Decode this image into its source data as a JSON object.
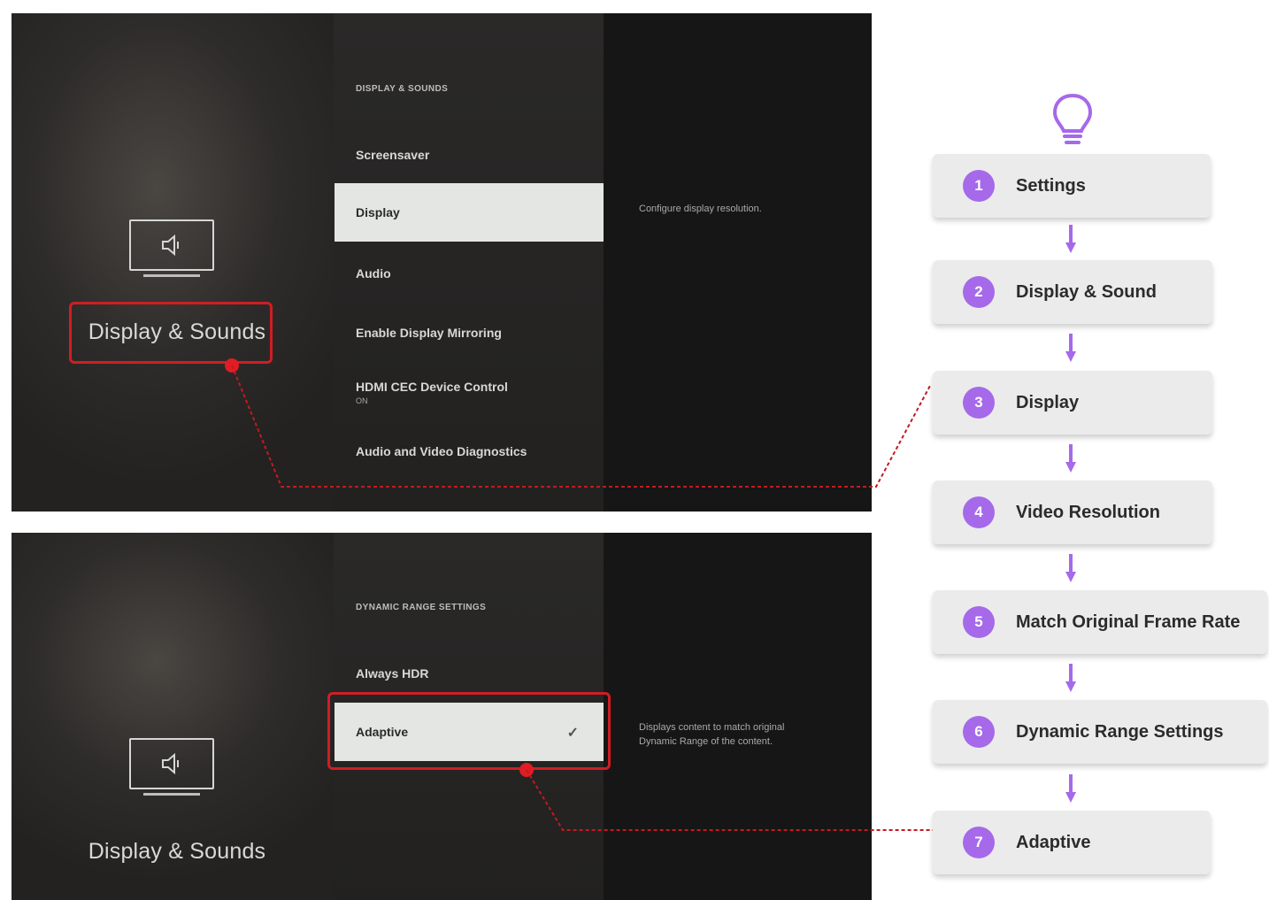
{
  "panels": [
    {
      "section_title": "Display & Sounds",
      "menu_header": "DISPLAY & SOUNDS",
      "items": [
        {
          "label": "Screensaver",
          "sub": ""
        },
        {
          "label": "Display",
          "sub": ""
        },
        {
          "label": "Audio",
          "sub": ""
        },
        {
          "label": "Enable Display Mirroring",
          "sub": ""
        },
        {
          "label": "HDMI CEC Device Control",
          "sub": "ON"
        },
        {
          "label": "Audio and Video Diagnostics",
          "sub": ""
        }
      ],
      "selected": "Display",
      "description": "Configure display resolution."
    },
    {
      "section_title": "Display & Sounds",
      "menu_header": "DYNAMIC RANGE SETTINGS",
      "items": [
        {
          "label": "Always HDR",
          "sub": ""
        },
        {
          "label": "Adaptive",
          "sub": "",
          "checked": "✓"
        }
      ],
      "selected": "Adaptive",
      "description": "Displays content to match original Dynamic Range of the content."
    }
  ],
  "steps": [
    {
      "num": "1",
      "label": "Settings"
    },
    {
      "num": "2",
      "label": "Display & Sound"
    },
    {
      "num": "3",
      "label": "Display"
    },
    {
      "num": "4",
      "label": "Video Resolution"
    },
    {
      "num": "5",
      "label": "Match Original Frame Rate"
    },
    {
      "num": "6",
      "label": "Dynamic Range Settings"
    },
    {
      "num": "7",
      "label": "Adaptive"
    }
  ],
  "icons": {
    "bulb": "lightbulb-icon",
    "tv": "tv-speaker-icon",
    "arrow": "arrow-down-icon"
  },
  "colors": {
    "accent": "#a569ea",
    "highlight": "#d01d25"
  }
}
